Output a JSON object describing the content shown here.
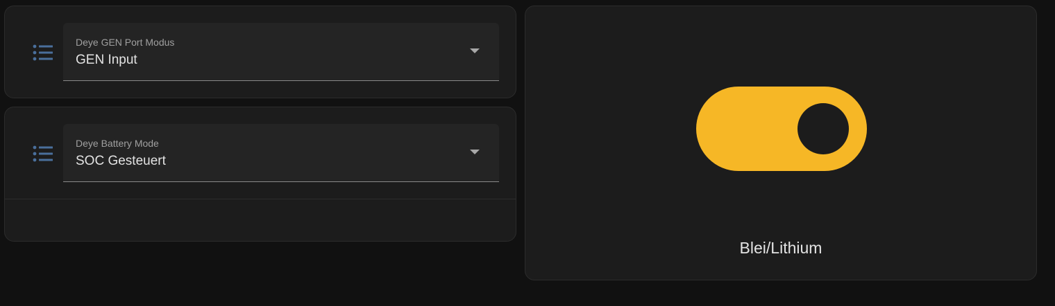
{
  "gen_port": {
    "icon": "format-list-bulleted-icon",
    "label": "Deye GEN Port Modus",
    "value": "GEN Input"
  },
  "battery_mode": {
    "icon": "format-list-bulleted-icon",
    "label": "Deye Battery Mode",
    "value": "SOC Gesteuert"
  },
  "toggle": {
    "name": "Blei/Lithium",
    "state": "on"
  },
  "colors": {
    "background": "#111111",
    "card": "#1c1c1c",
    "icon": "#4a6f9c",
    "toggle_on": "#f6b726",
    "text": "#e3e3e3",
    "secondary_text": "#a0a0a0"
  }
}
